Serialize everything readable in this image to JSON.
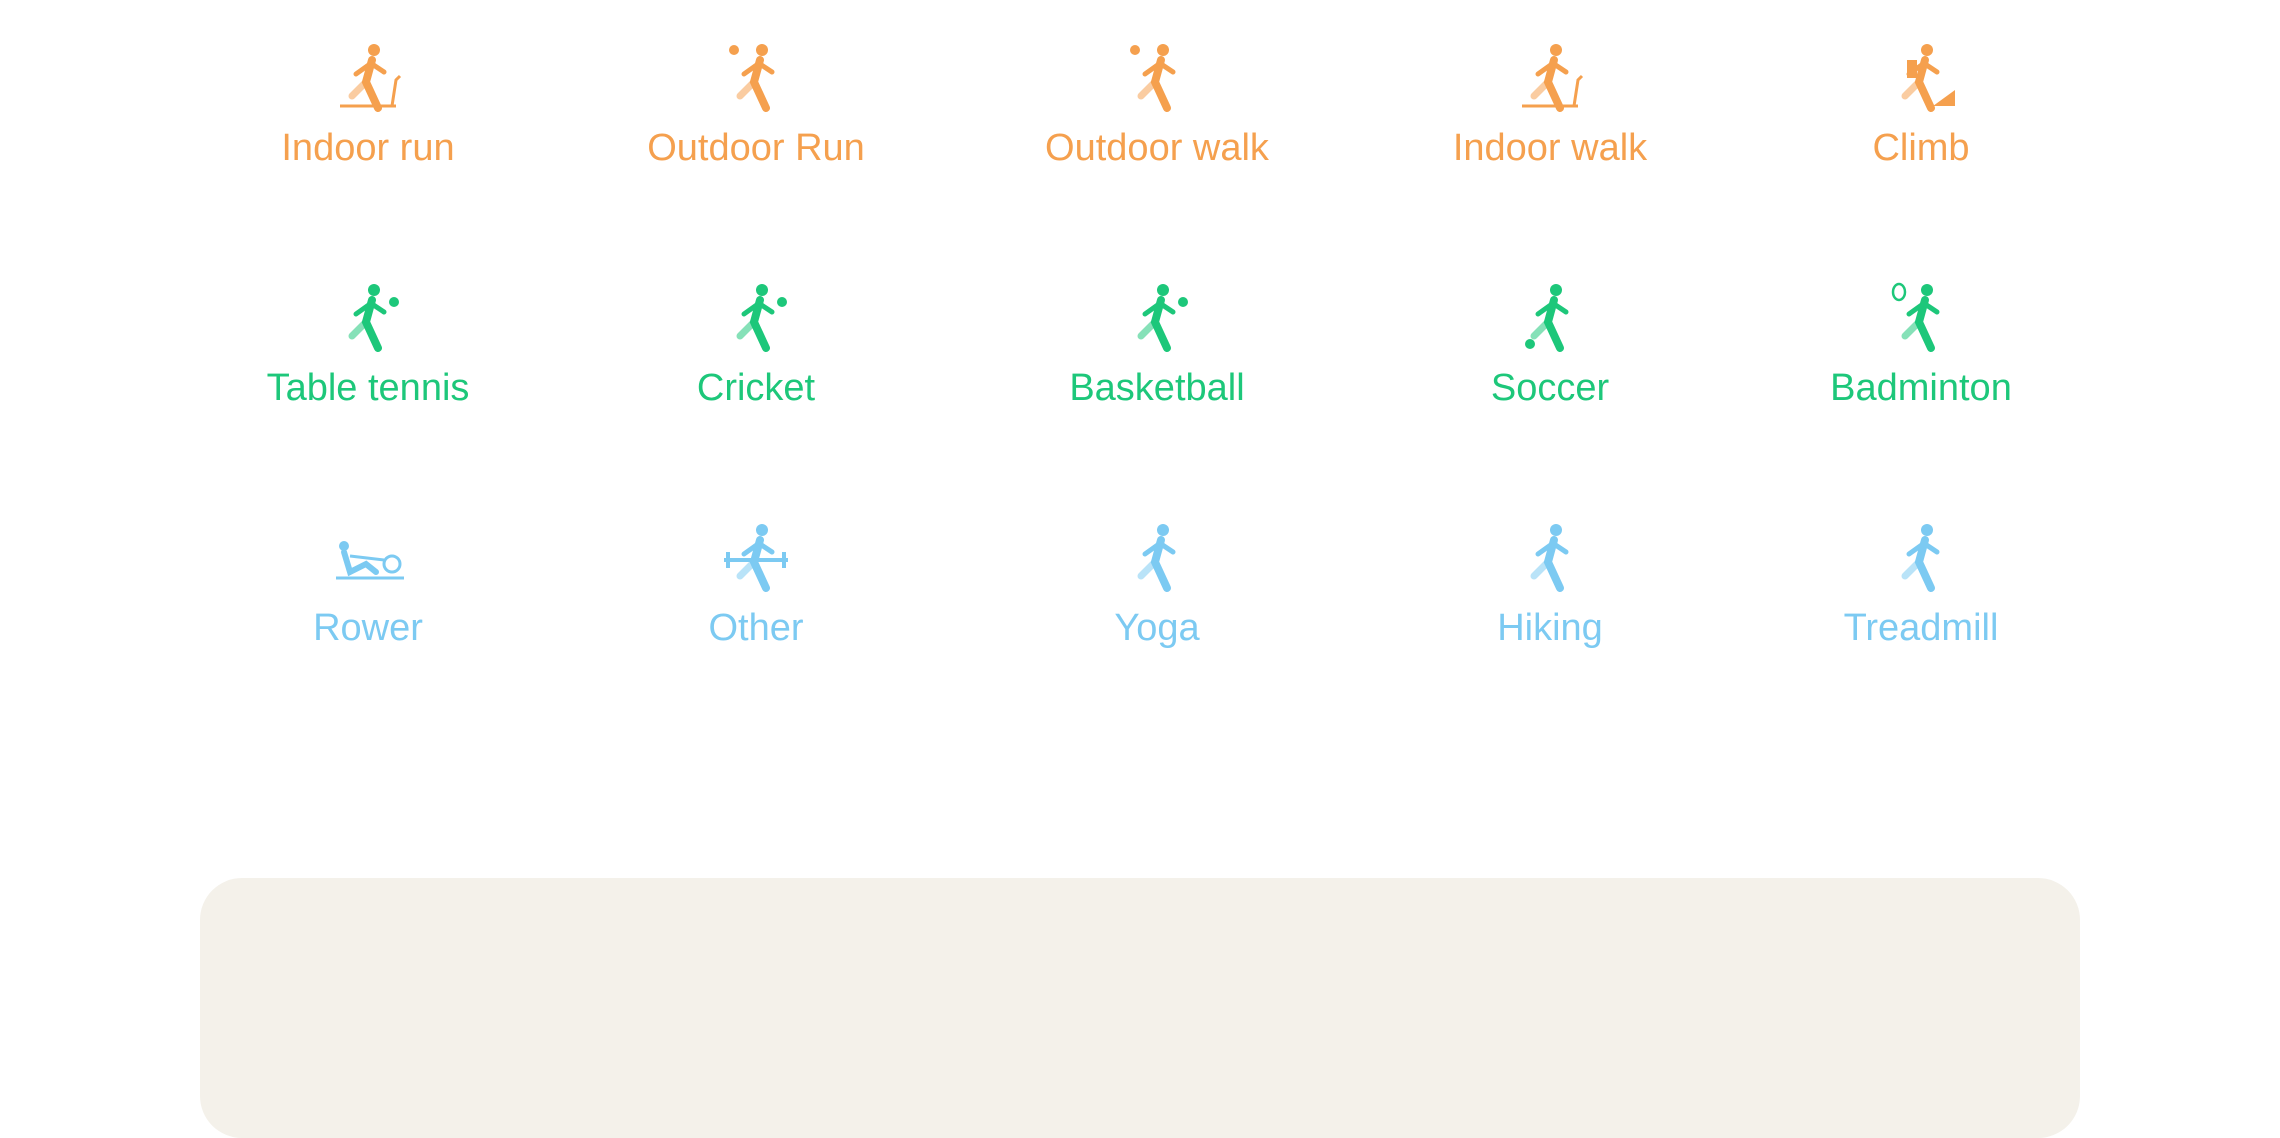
{
  "colors": {
    "cardio": "#f5a04e",
    "ball": "#1dc77a",
    "other": "#7ccaf2",
    "panel": "#f4f1ea"
  },
  "rows": [
    {
      "group": "cardio",
      "items": [
        {
          "label": "Indoor run",
          "icon": "indoor-run-icon"
        },
        {
          "label": "Outdoor Run",
          "icon": "outdoor-run-icon"
        },
        {
          "label": "Outdoor walk",
          "icon": "outdoor-walk-icon"
        },
        {
          "label": "Indoor walk",
          "icon": "indoor-walk-icon"
        },
        {
          "label": "Climb",
          "icon": "climb-icon"
        }
      ]
    },
    {
      "group": "ball",
      "items": [
        {
          "label": "Table tennis",
          "icon": "table-tennis-icon"
        },
        {
          "label": "Cricket",
          "icon": "cricket-icon"
        },
        {
          "label": "Basketball",
          "icon": "basketball-icon"
        },
        {
          "label": "Soccer",
          "icon": "soccer-icon"
        },
        {
          "label": "Badminton",
          "icon": "badminton-icon"
        }
      ]
    },
    {
      "group": "other",
      "items": [
        {
          "label": "Rower",
          "icon": "rower-icon"
        },
        {
          "label": "Other",
          "icon": "weightlifting-icon"
        },
        {
          "label": "Yoga",
          "icon": "yoga-icon"
        },
        {
          "label": "Hiking",
          "icon": "hiking-icon"
        },
        {
          "label": "Treadmill",
          "icon": "elliptical-icon"
        }
      ]
    }
  ]
}
